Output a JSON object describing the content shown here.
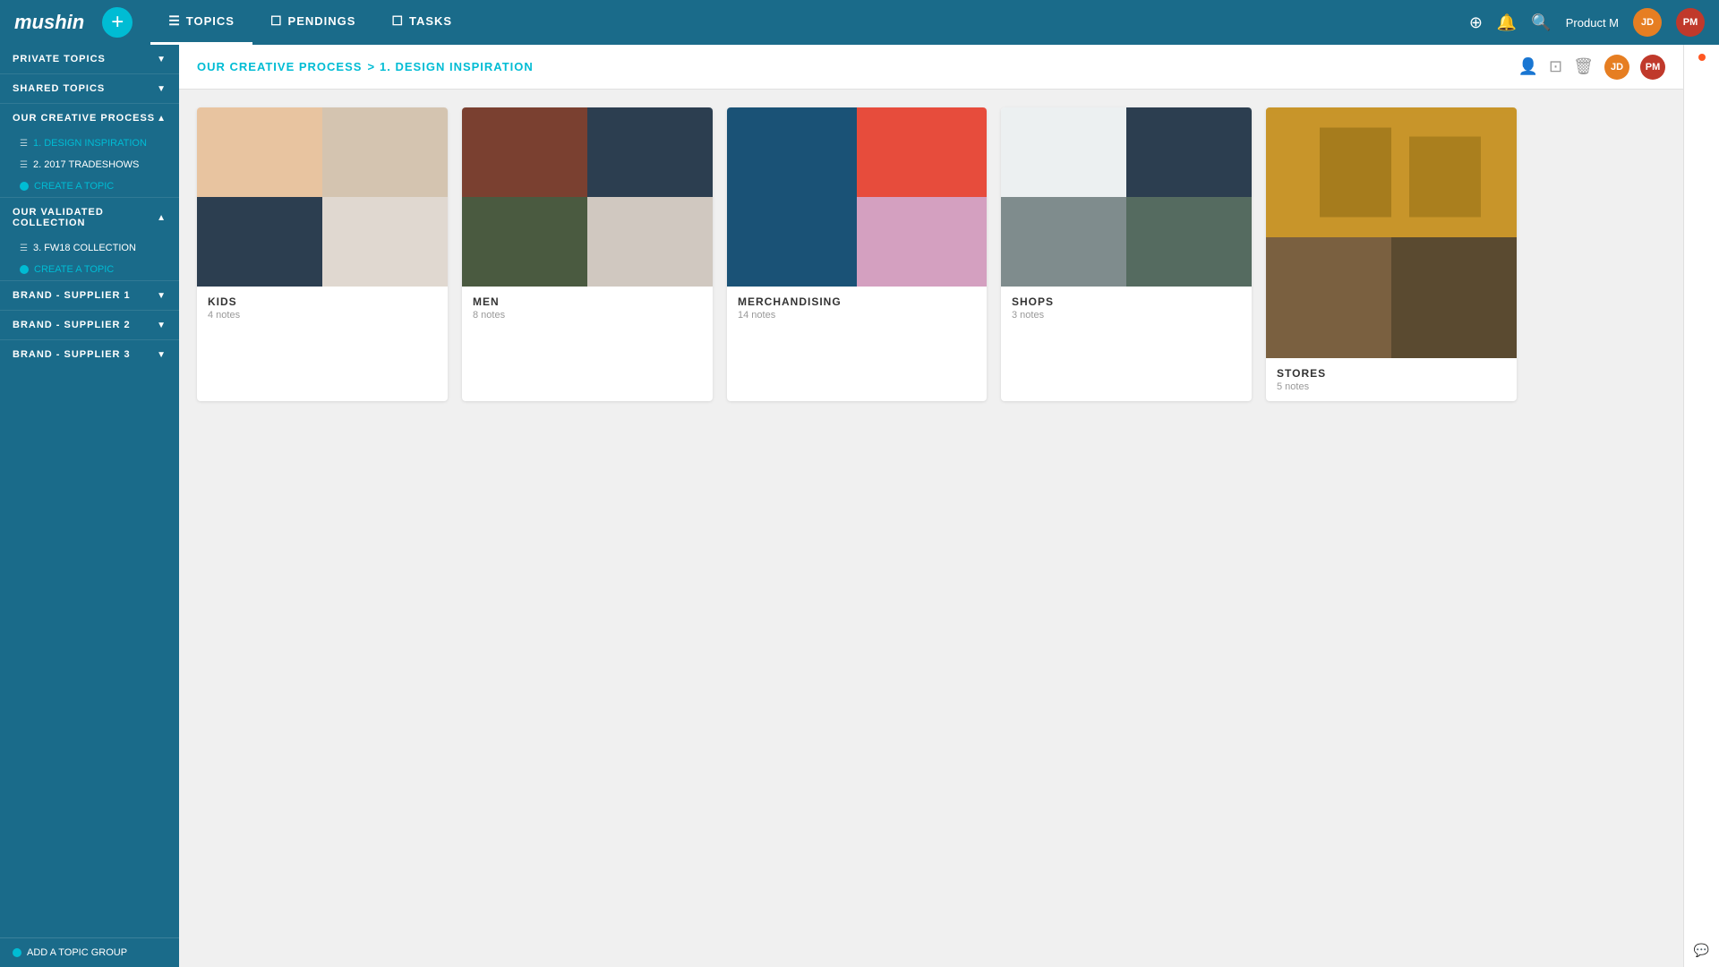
{
  "app": {
    "logo": "mushin",
    "add_button_label": "+"
  },
  "nav": {
    "tabs": [
      {
        "id": "topics",
        "label": "TOPICS",
        "icon": "☰",
        "active": true
      },
      {
        "id": "pendings",
        "label": "PENDINGS",
        "icon": "☐",
        "active": false
      },
      {
        "id": "tasks",
        "label": "TASKS",
        "icon": "☐",
        "active": false
      }
    ],
    "user_label": "Product M",
    "avatar1_initials": "JD",
    "avatar2_initials": "PM",
    "avatar1_color": "#e67e22",
    "avatar2_color": "#c0392b"
  },
  "sidebar": {
    "private_topics_label": "PRIVATE TOPICS",
    "shared_topics_label": "SHARED TOPICS",
    "our_creative_process_label": "OUR CREATIVE PROCESS",
    "item_design_inspiration": "1. DESIGN INSPIRATION",
    "item_tradeshows": "2. 2017 TRADESHOWS",
    "create_topic_1": "CREATE A TOPIC",
    "our_validated_collection_label": "OUR VALIDATED COLLECTION",
    "item_fw18": "3. FW18 COLLECTION",
    "create_topic_2": "CREATE A TOPIC",
    "brand_supplier_1": "BRAND - SUPPLIER 1",
    "brand_supplier_2": "BRAND - SUPPLIER 2",
    "brand_supplier_3": "BRAND - SUPPLIER 3",
    "add_topic_group": "ADD A TOPIC GROUP"
  },
  "breadcrumb": {
    "parent": "OUR CREATIVE PROCESS",
    "separator": ">",
    "current": "1. DESIGN INSPIRATION"
  },
  "topics": [
    {
      "id": "kids",
      "name": "KIDS",
      "notes": "4 notes",
      "colors": [
        "#f5c6a0",
        "#2c3e50",
        "#e8e8e8",
        "#3d5a80"
      ]
    },
    {
      "id": "men",
      "name": "MEN",
      "notes": "8 notes",
      "colors": [
        "#8b4513",
        "#2c3e50",
        "#556b2f",
        "#a0a0a0"
      ]
    },
    {
      "id": "merchandising",
      "name": "MERCHANDISING",
      "notes": "14 notes",
      "colors": [
        "#1a5276",
        "#e74c3c",
        "#f39c12"
      ]
    },
    {
      "id": "shops",
      "name": "SHOPS",
      "notes": "3 notes",
      "colors": [
        "#ecf0f1",
        "#2c3e50",
        "#7f8c8d"
      ]
    },
    {
      "id": "stores",
      "name": "STORES",
      "notes": "5 notes",
      "colors": [
        "#d4a04a",
        "#5a3e28",
        "#8b7355"
      ]
    }
  ]
}
